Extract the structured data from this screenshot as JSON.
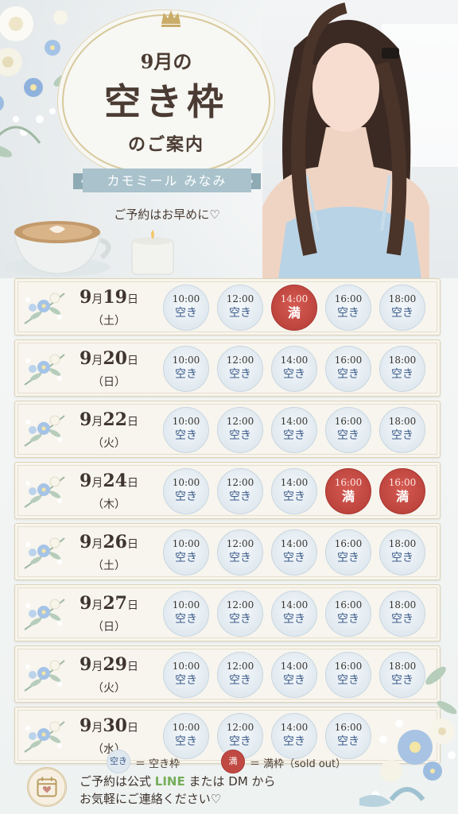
{
  "header": {
    "title_month": "9月の",
    "title_main": "空き枠",
    "title_sub": "のご案内",
    "name": "カモミール みなみ",
    "note": "ご予約はお早めに♡"
  },
  "colors": {
    "accent_gold": "#d8c99b",
    "ribbon_blue": "#a9c2cb",
    "open_slot": "#dfe8ef",
    "full_slot": "#c04a43",
    "line_green": "#76ae5a"
  },
  "days": [
    {
      "date_month": "9",
      "date_day": "19",
      "dow": "（土）",
      "slots": [
        {
          "time": "10:00",
          "status": "空き"
        },
        {
          "time": "12:00",
          "status": "空き"
        },
        {
          "time": "14:00",
          "status": "満"
        },
        {
          "time": "16:00",
          "status": "空き"
        },
        {
          "time": "18:00",
          "status": "空き"
        }
      ]
    },
    {
      "date_month": "9",
      "date_day": "20",
      "dow": "（日）",
      "slots": [
        {
          "time": "10:00",
          "status": "空き"
        },
        {
          "time": "12:00",
          "status": "空き"
        },
        {
          "time": "14:00",
          "status": "空き"
        },
        {
          "time": "16:00",
          "status": "空き"
        },
        {
          "time": "18:00",
          "status": "空き"
        }
      ]
    },
    {
      "date_month": "9",
      "date_day": "22",
      "dow": "（火）",
      "slots": [
        {
          "time": "10:00",
          "status": "空き"
        },
        {
          "time": "12:00",
          "status": "空き"
        },
        {
          "time": "14:00",
          "status": "空き"
        },
        {
          "time": "16:00",
          "status": "空き"
        },
        {
          "time": "18:00",
          "status": "空き"
        }
      ]
    },
    {
      "date_month": "9",
      "date_day": "24",
      "dow": "（木）",
      "slots": [
        {
          "time": "10:00",
          "status": "空き"
        },
        {
          "time": "12:00",
          "status": "空き"
        },
        {
          "time": "14:00",
          "status": "空き"
        },
        {
          "time": "16:00",
          "status": "満"
        },
        {
          "time": "16:00",
          "status": "満"
        }
      ]
    },
    {
      "date_month": "9",
      "date_day": "26",
      "dow": "（土）",
      "slots": [
        {
          "time": "10:00",
          "status": "空き"
        },
        {
          "time": "12:00",
          "status": "空き"
        },
        {
          "time": "14:00",
          "status": "空き"
        },
        {
          "time": "16:00",
          "status": "空き"
        },
        {
          "time": "18:00",
          "status": "空き"
        }
      ]
    },
    {
      "date_month": "9",
      "date_day": "27",
      "dow": "（日）",
      "slots": [
        {
          "time": "10:00",
          "status": "空き"
        },
        {
          "time": "12:00",
          "status": "空き"
        },
        {
          "time": "14:00",
          "status": "空き"
        },
        {
          "time": "16:00",
          "status": "空き"
        },
        {
          "time": "18:00",
          "status": "空き"
        }
      ]
    },
    {
      "date_month": "9",
      "date_day": "29",
      "dow": "（火）",
      "slots": [
        {
          "time": "10:00",
          "status": "空き"
        },
        {
          "time": "12:00",
          "status": "空き"
        },
        {
          "time": "14:00",
          "status": "空き"
        },
        {
          "time": "16:00",
          "status": "空き"
        },
        {
          "time": "18:00",
          "status": "空き"
        }
      ]
    },
    {
      "date_month": "9",
      "date_day": "30",
      "dow": "（水）",
      "slots": [
        {
          "time": "10:00",
          "status": "空き"
        },
        {
          "time": "12:00",
          "status": "空き"
        },
        {
          "time": "14:00",
          "status": "空き"
        },
        {
          "time": "16:00",
          "status": "空き"
        }
      ]
    }
  ],
  "legend": {
    "open_symbol": "空き",
    "open_text": "＝ 空き枠",
    "full_symbol": "満",
    "full_text": "＝ 満枠（sold out）"
  },
  "footer": {
    "line1_a": "ご予約は公式",
    "line1_b": "LINE",
    "line1_c": "または DM から",
    "line2": "お気軽にご連絡ください♡"
  }
}
